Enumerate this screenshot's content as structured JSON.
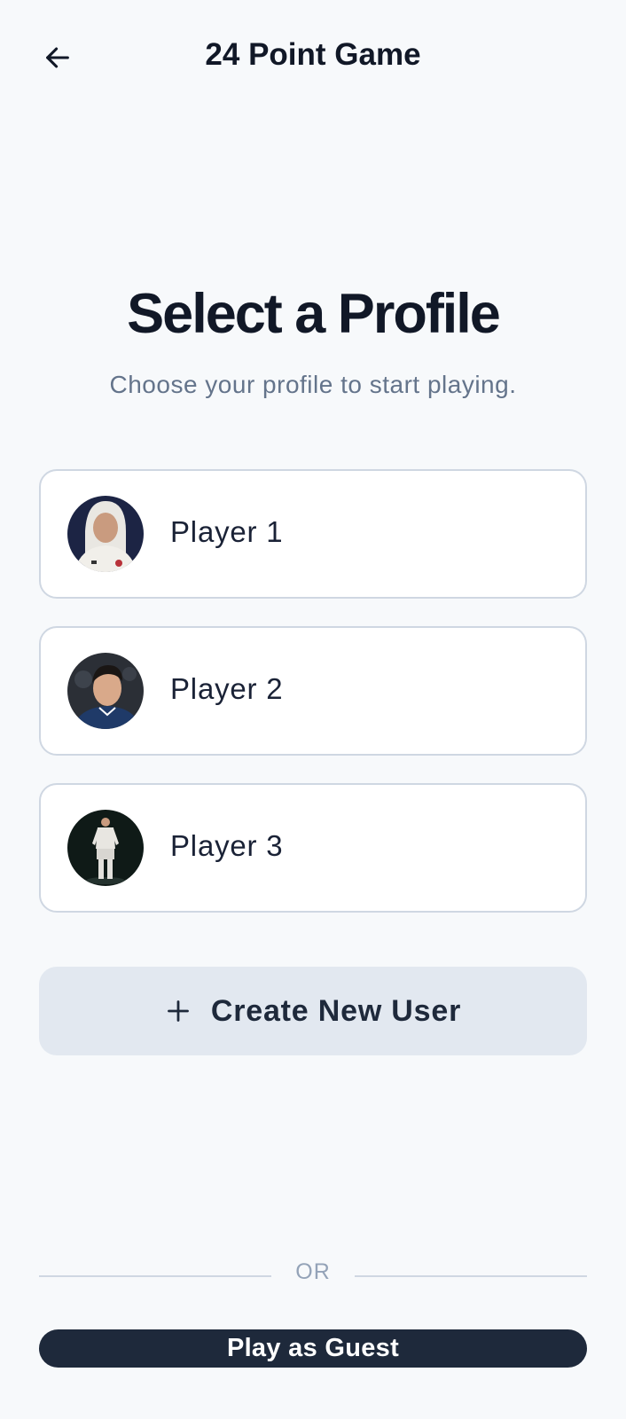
{
  "header": {
    "title": "24 Point Game",
    "back_icon": "arrow-left-icon"
  },
  "main": {
    "title": "Select a Profile",
    "subtitle": "Choose your profile to start playing."
  },
  "profiles": [
    {
      "name": "Player 1",
      "avatar": "player-1-avatar"
    },
    {
      "name": "Player 2",
      "avatar": "player-2-avatar"
    },
    {
      "name": "Player 3",
      "avatar": "player-3-avatar"
    }
  ],
  "actions": {
    "create_label": "Create New User",
    "create_icon": "plus-icon",
    "or_label": "OR",
    "guest_label": "Play as Guest"
  },
  "colors": {
    "background": "#f7f9fb",
    "card_border": "#cfd7e2",
    "create_button_bg": "#e2e8f0",
    "guest_button_bg": "#1e293b",
    "subtitle_text": "#64748b"
  }
}
